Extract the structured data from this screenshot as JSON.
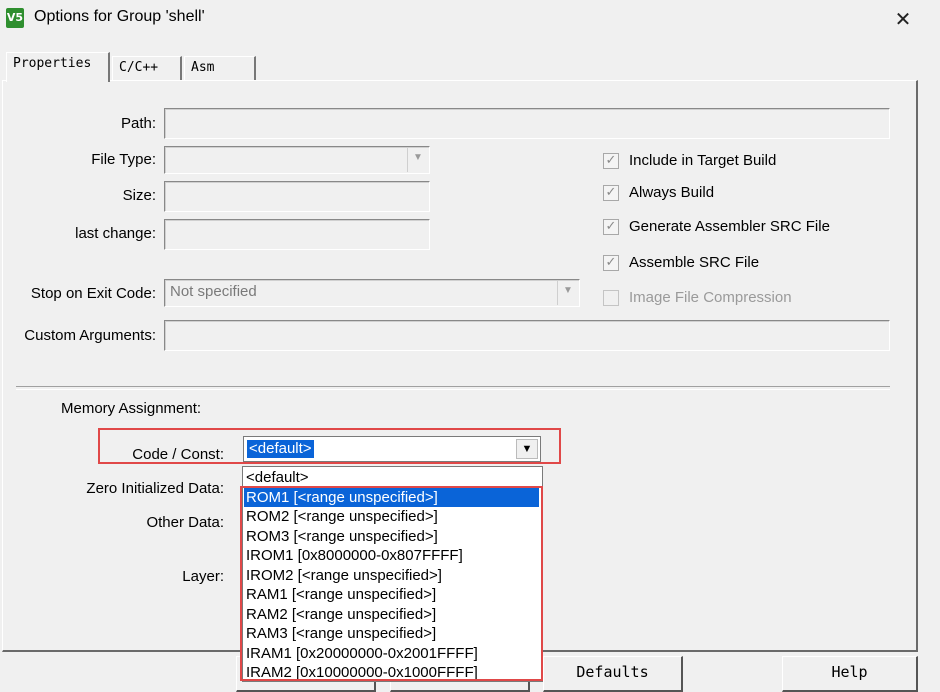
{
  "window": {
    "title": "Options for Group 'shell'",
    "icon_text": "V5",
    "close_glyph": "✕"
  },
  "tabs": [
    {
      "label": "Properties"
    },
    {
      "label": "C/C++"
    },
    {
      "label": "Asm"
    }
  ],
  "form": {
    "path_label": "Path:",
    "file_type_label": "File Type:",
    "size_label": "Size:",
    "last_change_label": "last change:",
    "stop_on_exit_label": "Stop on Exit Code:",
    "stop_on_exit_value": "Not specified",
    "custom_args_label": "Custom Arguments:"
  },
  "checkboxes": [
    {
      "label": "Include in Target Build",
      "checked": true,
      "enabled": true
    },
    {
      "label": "Always Build",
      "checked": true,
      "enabled": true
    },
    {
      "label": "Generate Assembler SRC File",
      "checked": true,
      "enabled": true
    },
    {
      "label": "Assemble SRC File",
      "checked": true,
      "enabled": true
    },
    {
      "label": "Image File Compression",
      "checked": false,
      "enabled": false
    }
  ],
  "memory": {
    "section_label": "Memory Assignment:",
    "code_const_label": "Code / Const:",
    "code_const_value": "<default>",
    "zero_init_label": "Zero Initialized Data:",
    "other_data_label": "Other Data:",
    "layer_label": "Layer:"
  },
  "dropdown_options": [
    "<default>",
    "ROM1 [<range unspecified>]",
    "ROM2 [<range unspecified>]",
    "ROM3 [<range unspecified>]",
    "IROM1 [0x8000000-0x807FFFF]",
    "IROM2 [<range unspecified>]",
    "RAM1 [<range unspecified>]",
    "RAM2 [<range unspecified>]",
    "RAM3 [<range unspecified>]",
    "IRAM1 [0x20000000-0x2001FFFF]",
    "IRAM2 [0x10000000-0x1000FFFF]"
  ],
  "dropdown_selected": "ROM1 [<range unspecified>]",
  "buttons": {
    "defaults": "Defaults",
    "help": "Help"
  },
  "colors": {
    "highlight_box": "#e04848",
    "selection": "#0a64d8"
  },
  "icons": {
    "checkmark": "✓",
    "combo_arrow": "▼"
  }
}
